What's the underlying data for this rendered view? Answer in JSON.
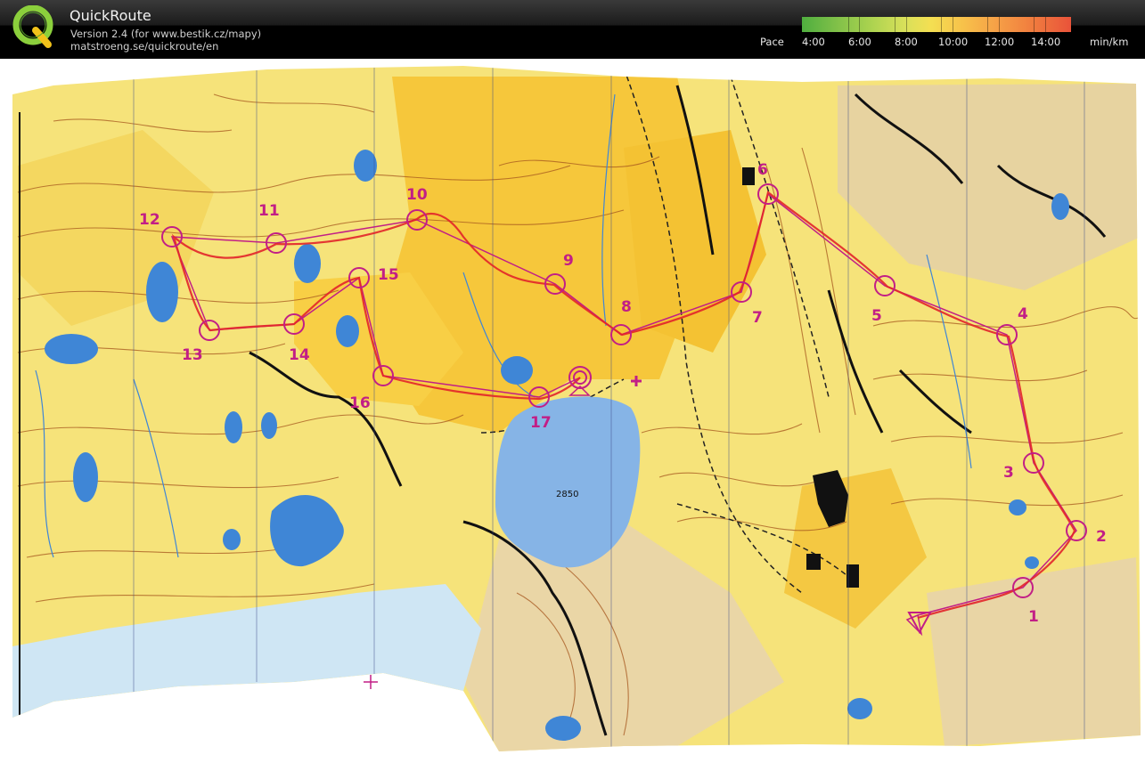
{
  "app": {
    "title": "QuickRoute",
    "version_line": "Version 2.4  (for www.bestik.cz/mapy)",
    "url_line": "matstroeng.se/quickroute/en"
  },
  "legend": {
    "label": "Pace",
    "ticks": [
      "4:00",
      "6:00",
      "8:00",
      "10:00",
      "12:00",
      "14:00"
    ],
    "unit": "min/km",
    "colors": [
      "#4fae3f",
      "#a9d24f",
      "#f4df52",
      "#f6a147",
      "#e9533a"
    ]
  },
  "map": {
    "lake_label": "2850",
    "controls": [
      "1",
      "2",
      "3",
      "4",
      "5",
      "6",
      "7",
      "8",
      "9",
      "10",
      "11",
      "12",
      "13",
      "14",
      "15",
      "16",
      "17"
    ],
    "colors": {
      "terrain": "#f6e37a",
      "open": "#f6c73b",
      "contour": "#a6571e",
      "water": "#3f86d6",
      "lake": "#86b4e6",
      "course": "#c21e86",
      "route": "#e2232a",
      "snow": "#cfe6f4"
    }
  }
}
